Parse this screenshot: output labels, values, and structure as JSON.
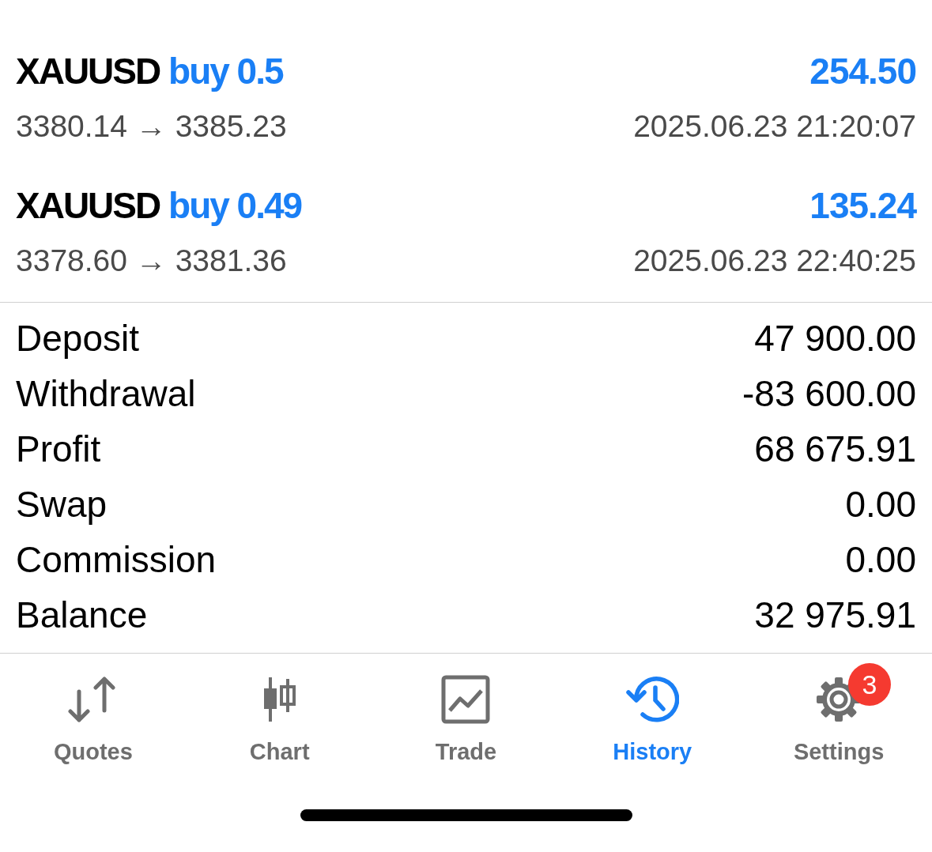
{
  "deals": [
    {
      "symbol": "XAUUSD",
      "side": "buy",
      "volume": "0.5",
      "profit": "254.50",
      "prices": "3380.14 → 3385.23",
      "time": "2025.06.23 21:20:07"
    },
    {
      "symbol": "XAUUSD",
      "side": "buy",
      "volume": "0.49",
      "profit": "135.24",
      "prices": "3378.60 → 3381.36",
      "time": "2025.06.23 22:40:25"
    }
  ],
  "summary": [
    {
      "label": "Deposit",
      "value": "47 900.00"
    },
    {
      "label": "Withdrawal",
      "value": "-83 600.00"
    },
    {
      "label": "Profit",
      "value": "68 675.91"
    },
    {
      "label": "Swap",
      "value": "0.00"
    },
    {
      "label": "Commission",
      "value": "0.00"
    },
    {
      "label": "Balance",
      "value": "32 975.91"
    }
  ],
  "tabs": [
    {
      "label": "Quotes",
      "selected": false
    },
    {
      "label": "Chart",
      "selected": false
    },
    {
      "label": "Trade",
      "selected": false
    },
    {
      "label": "History",
      "selected": true
    },
    {
      "label": "Settings",
      "selected": false,
      "badge": "3"
    }
  ]
}
